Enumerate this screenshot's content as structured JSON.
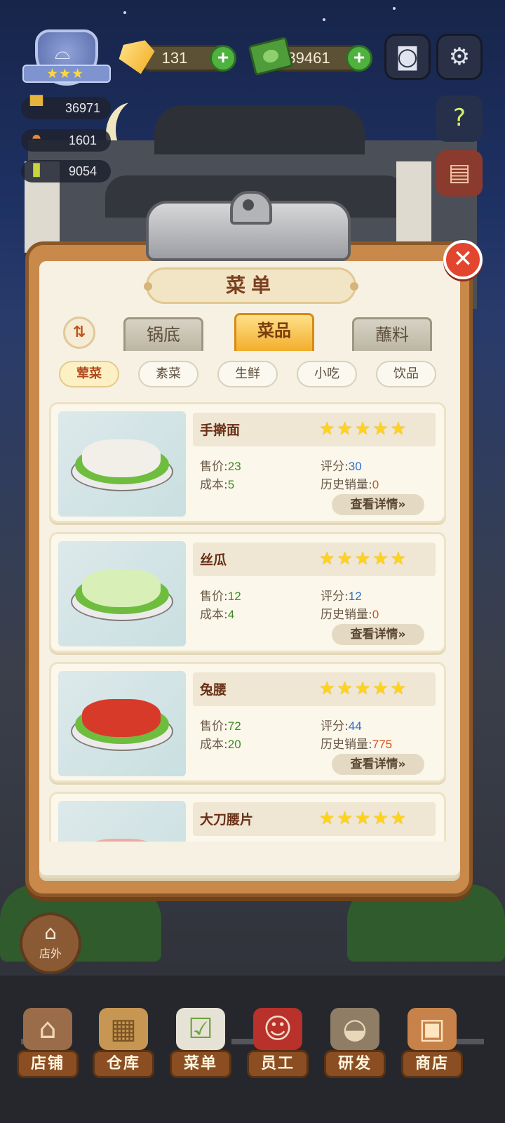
{
  "hud": {
    "rank_stars": "★★★",
    "gems": "131",
    "cash": "39461",
    "stats": [
      {
        "icon": "pot-icon",
        "value": "36971"
      },
      {
        "icon": "cloche-icon",
        "value": "1601"
      },
      {
        "icon": "recipe-icon",
        "value": "9054"
      }
    ]
  },
  "panel": {
    "title": "菜单",
    "tabs": [
      "锅底",
      "菜品",
      "蘸料"
    ],
    "active_tab": 1,
    "subtabs": [
      "荤菜",
      "素菜",
      "生鲜",
      "小吃",
      "饮品"
    ],
    "active_subtab": 0,
    "detail_label": "查看详情»",
    "labels": {
      "price": "售价:",
      "cost": "成本:",
      "score": "评分:",
      "sales": "历史销量:"
    },
    "dishes": [
      {
        "name": "手擀面",
        "stars": "★★★★★",
        "price": "23",
        "cost": "5",
        "score": "30",
        "sales": "0",
        "food_color": "#f1efe8"
      },
      {
        "name": "丝瓜",
        "stars": "★★★★★",
        "price": "12",
        "cost": "4",
        "score": "12",
        "sales": "0",
        "food_color": "#d8efb8"
      },
      {
        "name": "兔腰",
        "stars": "★★★★★",
        "price": "72",
        "cost": "20",
        "score": "44",
        "sales": "775",
        "food_color": "#d83a2a"
      },
      {
        "name": "大刀腰片",
        "stars": "★★★★★",
        "price": "",
        "cost": "",
        "score": "",
        "sales": "",
        "food_color": "#f0a9a0"
      }
    ]
  },
  "outside_label": "店外",
  "nav": [
    {
      "label": "店铺",
      "icon": "shop-icon"
    },
    {
      "label": "仓库",
      "icon": "warehouse-icon"
    },
    {
      "label": "菜单",
      "icon": "clipboard-icon"
    },
    {
      "label": "员工",
      "icon": "staff-icon"
    },
    {
      "label": "研发",
      "icon": "wok-icon"
    },
    {
      "label": "商店",
      "icon": "store-icon"
    }
  ],
  "colors": {
    "accent": "#f2ae2c",
    "close": "#e2462f",
    "plus": "#4fb13e"
  }
}
